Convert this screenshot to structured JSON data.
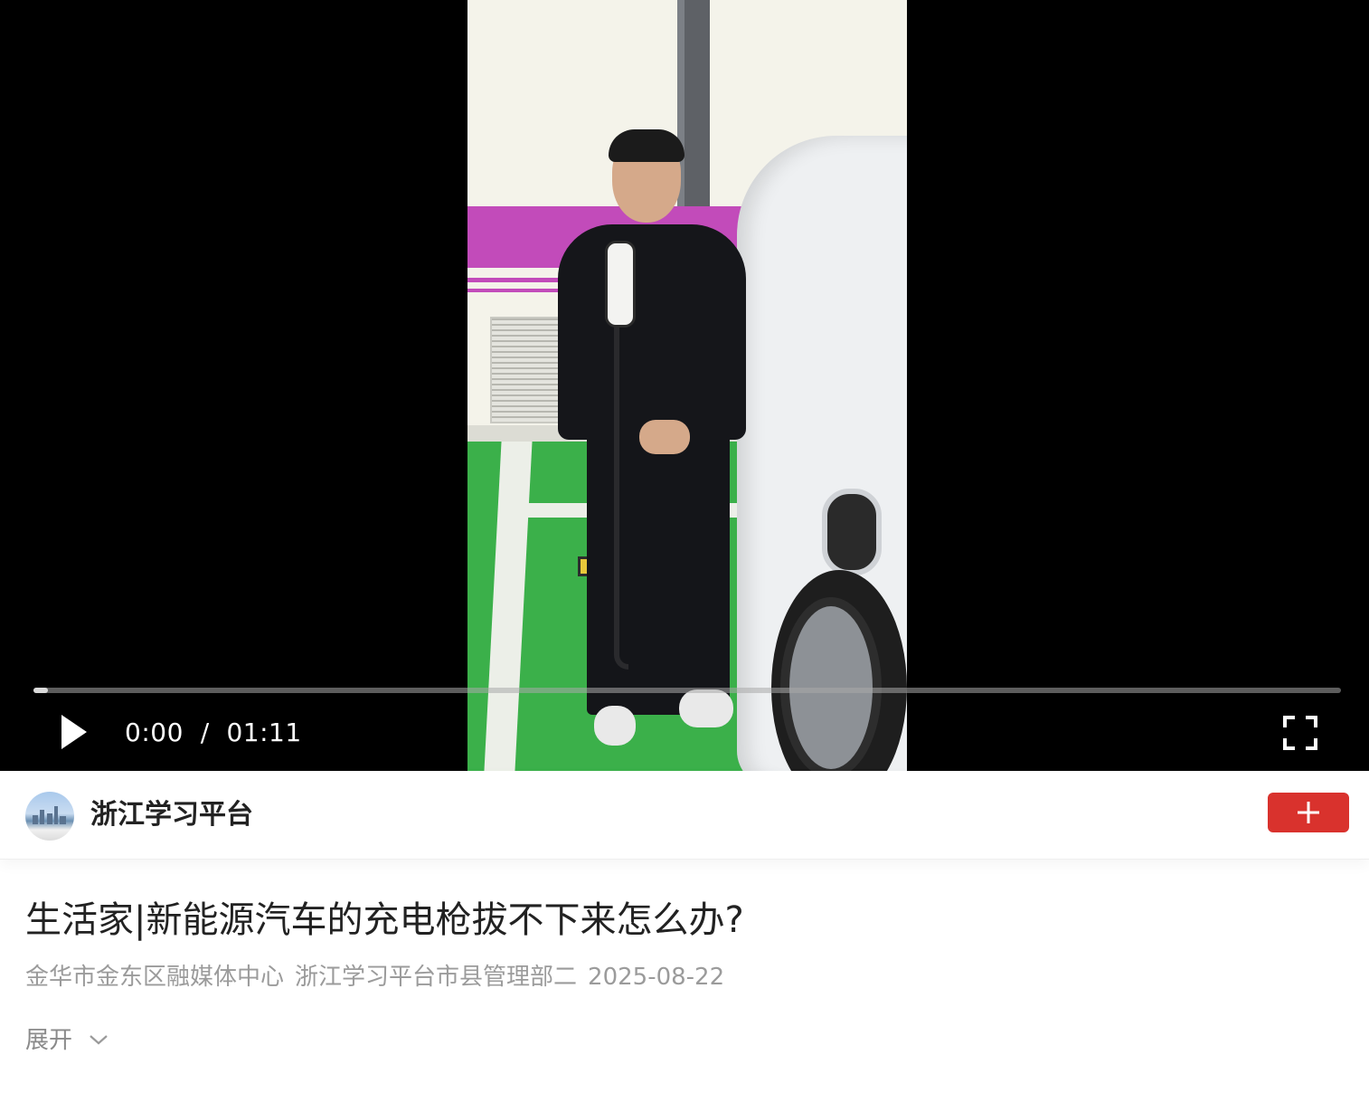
{
  "video": {
    "current_time": "0:00",
    "separator": "/",
    "duration": "01:11",
    "progress_fraction": 0.011,
    "icons": {
      "play": "play-icon",
      "fullscreen": "fullscreen-icon"
    }
  },
  "author": {
    "name": "浙江学习平台",
    "avatar_icon": "city-skyline-avatar",
    "follow_icon": "plus-icon",
    "follow_color": "#d9322d"
  },
  "article": {
    "title": "生活家|新能源汽车的充电枪拔不下来怎么办?",
    "source": "金华市金东区融媒体中心",
    "department": "浙江学习平台市县管理部二",
    "date": "2025-08-22",
    "expand_label": "展开",
    "expand_icon": "chevron-down-icon"
  }
}
